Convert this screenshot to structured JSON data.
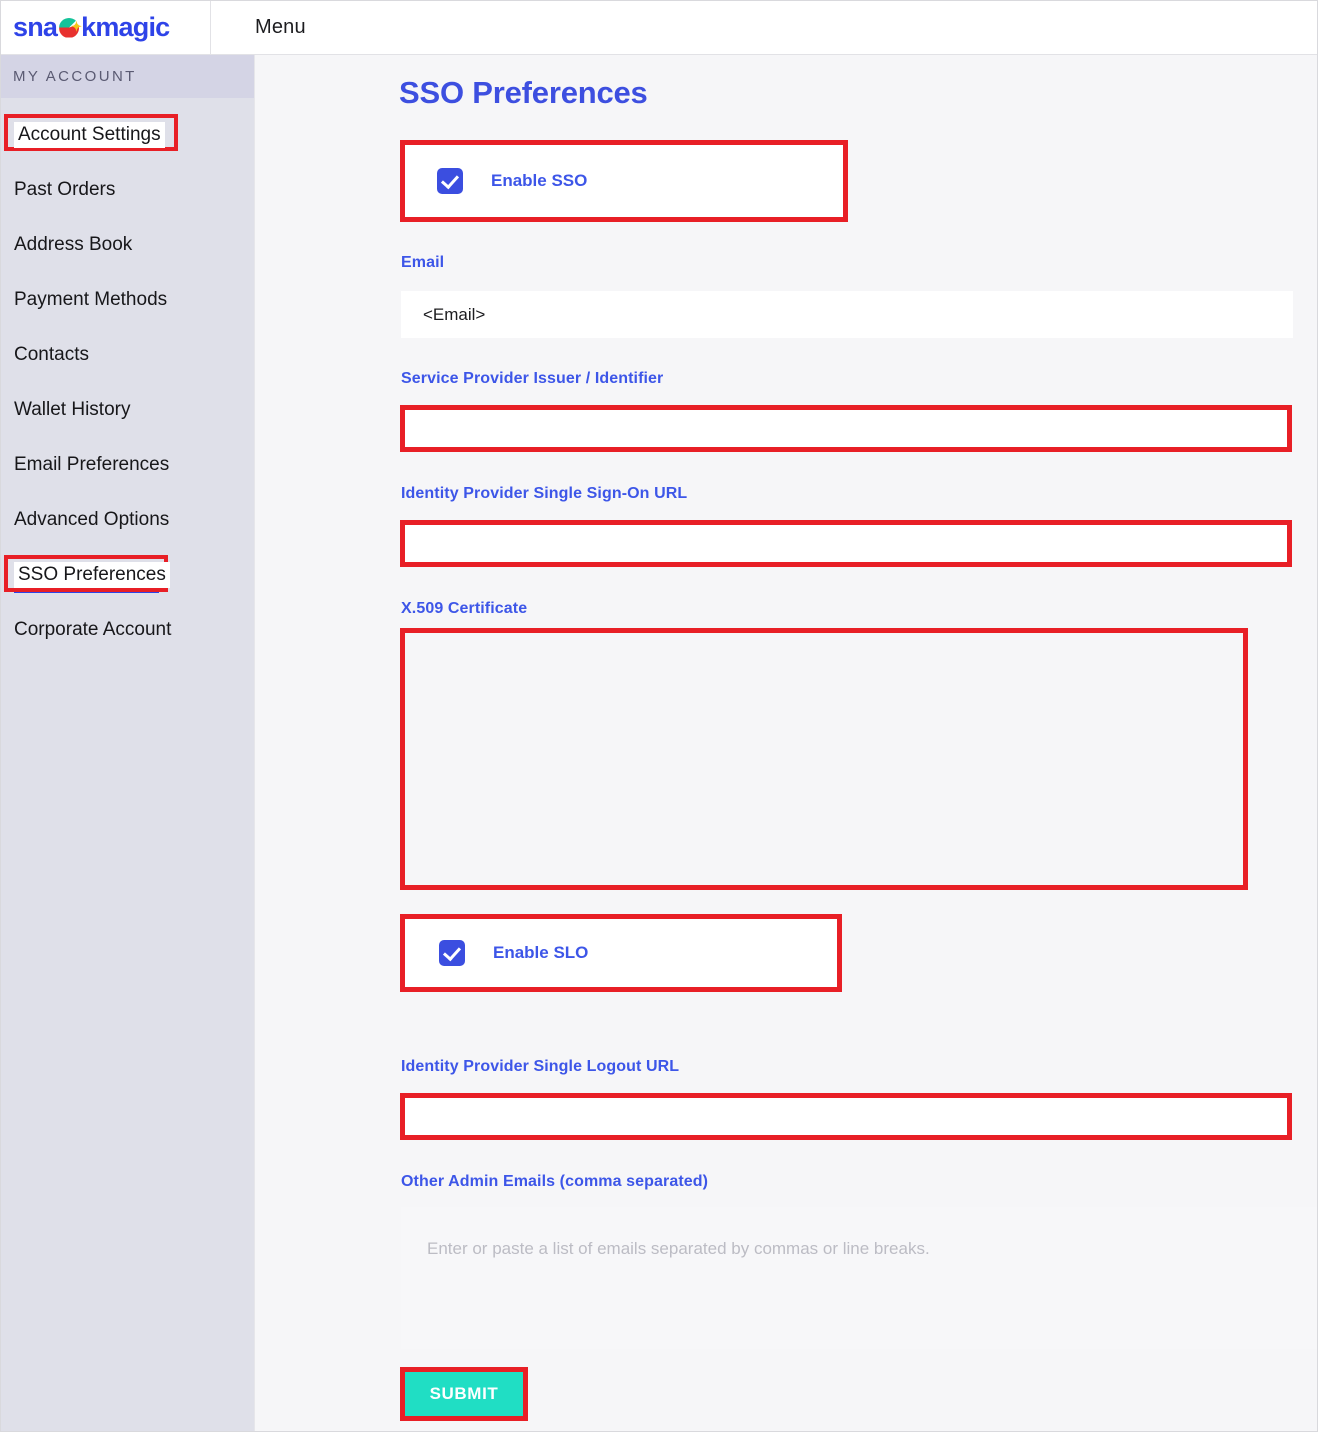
{
  "header": {
    "logo_prefix": "sna",
    "logo_suffix": "kmagic",
    "logo_icon": "snack-pacman-icon",
    "menu_label": "Menu"
  },
  "sidebar": {
    "section_title": "MY ACCOUNT",
    "items": [
      {
        "label": "Account Settings",
        "highlighted": true,
        "active": false
      },
      {
        "label": "Past Orders",
        "highlighted": false,
        "active": false
      },
      {
        "label": "Address Book",
        "highlighted": false,
        "active": false
      },
      {
        "label": "Payment Methods",
        "highlighted": false,
        "active": false
      },
      {
        "label": "Contacts",
        "highlighted": false,
        "active": false
      },
      {
        "label": "Wallet History",
        "highlighted": false,
        "active": false
      },
      {
        "label": "Email Preferences",
        "highlighted": false,
        "active": false
      },
      {
        "label": "Advanced Options",
        "highlighted": false,
        "active": false
      },
      {
        "label": "SSO Preferences",
        "highlighted": true,
        "active": true
      },
      {
        "label": "Corporate Account",
        "highlighted": false,
        "active": false
      }
    ]
  },
  "main": {
    "title": "SSO Preferences",
    "enable_sso": {
      "label": "Enable SSO",
      "checked": true
    },
    "email": {
      "label": "Email",
      "value": "<Email>",
      "placeholder": ""
    },
    "sp_issuer": {
      "label": "Service Provider Issuer / Identifier",
      "value": "",
      "placeholder": ""
    },
    "idp_sso_url": {
      "label": "Identity Provider Single Sign-On URL",
      "value": "",
      "placeholder": ""
    },
    "x509": {
      "label": "X.509 Certificate",
      "value": "",
      "placeholder": ""
    },
    "enable_slo": {
      "label": "Enable SLO",
      "checked": true
    },
    "idp_slo_url": {
      "label": "Identity Provider Single Logout URL",
      "value": "",
      "placeholder": ""
    },
    "other_admin_emails": {
      "label": "Other Admin Emails (comma separated)",
      "value": "",
      "placeholder": "Enter or paste a list of emails separated by commas or line breaks."
    },
    "submit_label": "SUBMIT"
  },
  "colors": {
    "brand_blue": "#2e43e8",
    "label_blue": "#3d56e8",
    "title_blue": "#3d4fe0",
    "annotation_red": "#e81f26",
    "submit_teal": "#20dec4",
    "sidebar_bg": "#dfe0e9",
    "sidebar_header_bg": "#d4d4e5",
    "content_bg": "#f6f6f8",
    "checkbox_blue": "#3b4ee0"
  }
}
